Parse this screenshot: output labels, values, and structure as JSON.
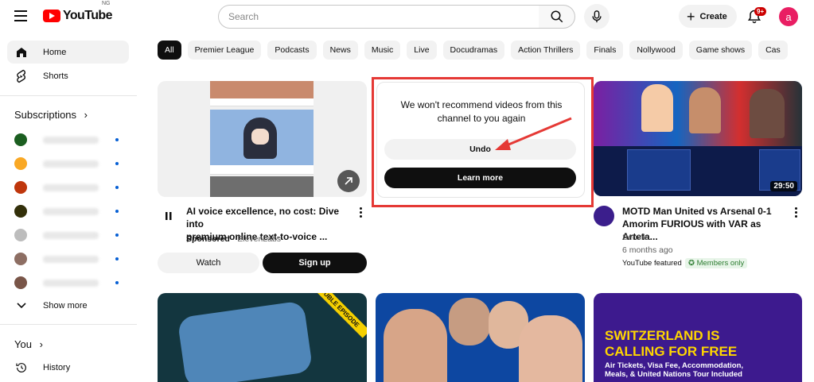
{
  "header": {
    "logo_text": "YouTube",
    "logo_country": "NG",
    "search_placeholder": "Search",
    "create_label": "Create",
    "notifications_badge": "9+",
    "avatar_letter": "a",
    "brand_color": "#ff0000"
  },
  "sidebar": {
    "items": [
      {
        "label": "Home",
        "icon": "home-icon"
      },
      {
        "label": "Shorts",
        "icon": "shorts-icon"
      }
    ],
    "subscriptions_title": "Subscriptions",
    "show_more": "Show more",
    "you_title": "You",
    "history": "History"
  },
  "chips": [
    "All",
    "Premier League",
    "Podcasts",
    "News",
    "Music",
    "Live",
    "Docudramas",
    "Action Thrillers",
    "Finals",
    "Nollywood",
    "Game shows",
    "Cas"
  ],
  "ad_card": {
    "title_line1": "AI voice excellence, no cost: Dive into",
    "title_line2": "premium online text-to-voice ...",
    "sponsored": "Sponsored",
    "advertiser": "ElevenLabs",
    "watch_label": "Watch",
    "signup_label": "Sign up"
  },
  "removed_dialog": {
    "message_line1": "We won't recommend videos from this",
    "message_line2": "channel to you again",
    "undo_label": "Undo",
    "learn_more_label": "Learn more",
    "highlight_color": "#e53935"
  },
  "video_card": {
    "title_line1": "MOTD Man United vs Arsenal 0-1",
    "title_line2": "Amorim FURIOUS with VAR as Arteta...",
    "channel": "Senvik",
    "age": "6 months ago",
    "featured": "YouTube featured",
    "members_only": "Members only",
    "duration": "29:50"
  },
  "bottom_thumbs": {
    "first_badge": "DOUBLE EPISODE",
    "third_line1": "SWITZERLAND IS",
    "third_line2": "CALLING FOR FREE",
    "third_sub1": "Air Tickets, Visa Fee, Accommodation,",
    "third_sub2": "Meals, & United Nations Tour Included"
  }
}
